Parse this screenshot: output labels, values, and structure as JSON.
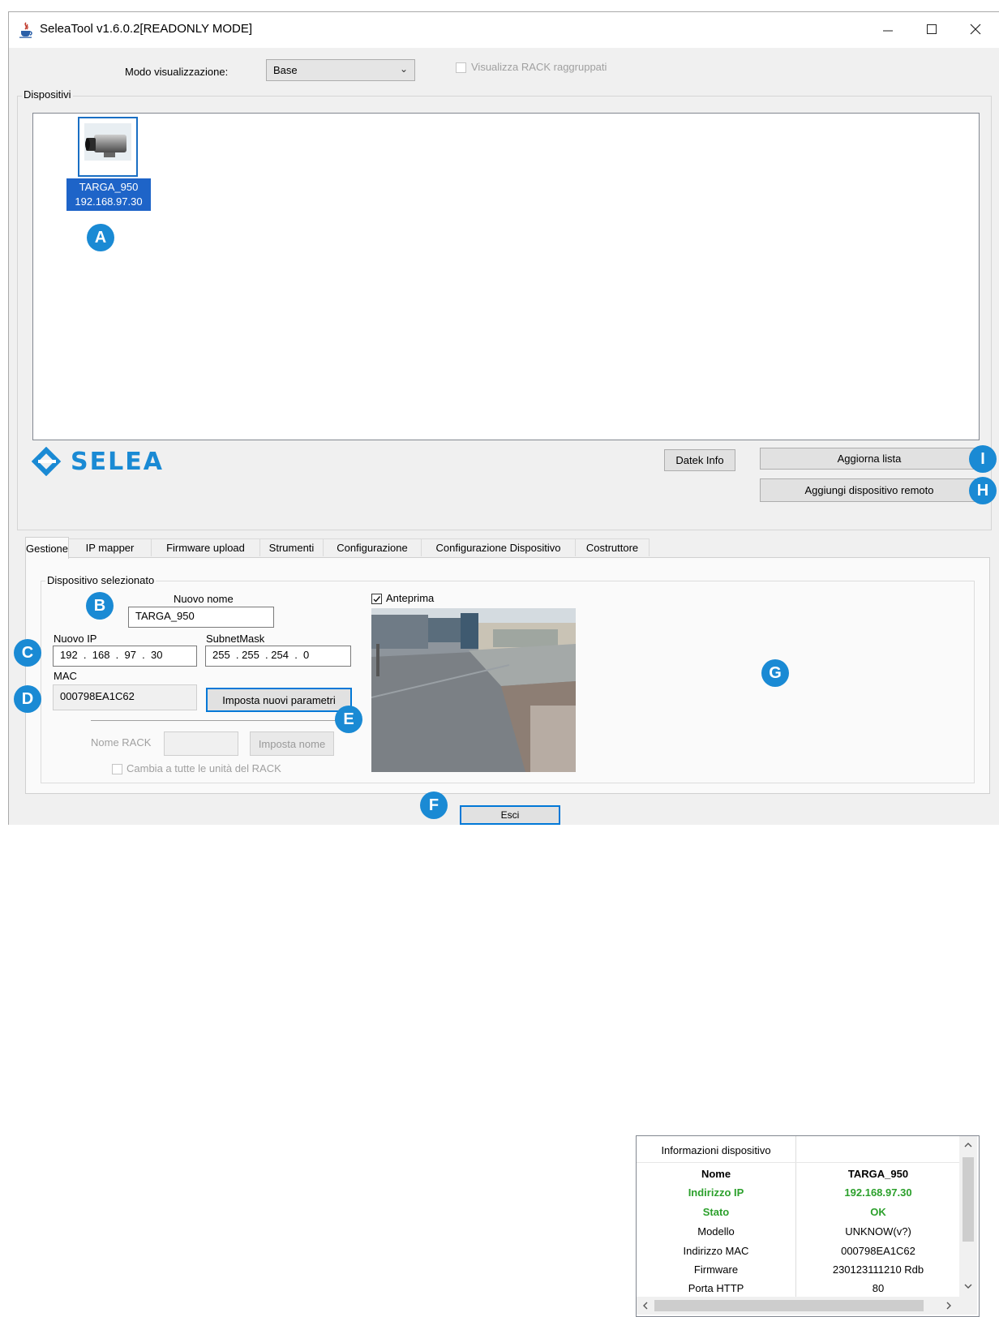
{
  "window": {
    "title": "SeleaTool v1.6.0.2[READONLY MODE]"
  },
  "toolbar": {
    "view_mode_label": "Modo visualizzazione:",
    "view_mode_value": "Base",
    "rack_grouped_label": "Visualizza RACK raggruppati",
    "rack_grouped_checked": false
  },
  "devices": {
    "legend": "Dispositivi",
    "items": [
      {
        "name": "TARGA_950",
        "ip": "192.168.97.30",
        "selected": true
      }
    ]
  },
  "brand": {
    "name": "SELEA",
    "color": "#1a8ad4"
  },
  "buttons": {
    "datek_info": "Datek Info",
    "refresh_list": "Aggiorna lista",
    "add_remote": "Aggiungi dispositivo remoto",
    "set_params": "Imposta nuovi parametri",
    "set_name": "Imposta nome",
    "exit": "Esci"
  },
  "tabs": [
    {
      "label": "Gestione",
      "active": true
    },
    {
      "label": "IP mapper"
    },
    {
      "label": "Firmware upload"
    },
    {
      "label": "Strumenti"
    },
    {
      "label": "Configurazione"
    },
    {
      "label": "Configurazione Dispositivo"
    },
    {
      "label": "Costruttore"
    }
  ],
  "selected_device": {
    "legend": "Dispositivo selezionato",
    "new_name_label": "Nuovo nome",
    "new_name_value": "TARGA_950",
    "new_ip_label": "Nuovo IP",
    "new_ip_value": "192  .  168  .  97  .  30",
    "subnet_label": "SubnetMask",
    "subnet_value": "255  . 255  . 254  .  0",
    "mac_label": "MAC",
    "mac_value": "000798EA1C62",
    "rack_name_label": "Nome RACK",
    "rack_name_value": "",
    "apply_all_rack_label": "Cambia a tutte le unità del RACK",
    "apply_all_rack_checked": false
  },
  "preview": {
    "label": "Anteprima",
    "checked": true
  },
  "device_info": {
    "header": "Informazioni dispositivo",
    "rows": [
      {
        "key": "Nome",
        "value": "TARGA_950",
        "bold": true
      },
      {
        "key": "Indirizzo IP",
        "value": "192.168.97.30",
        "color": "#2ca02c",
        "bold": true
      },
      {
        "key": "Stato",
        "value": "OK",
        "color": "#2ca02c",
        "bold": true
      },
      {
        "key": "Modello",
        "value": "UNKNOW(v?)"
      },
      {
        "key": "Indirizzo MAC",
        "value": "000798EA1C62"
      },
      {
        "key": "Firmware",
        "value": "230123111210 Rdb"
      },
      {
        "key": "Porta HTTP",
        "value": "80"
      }
    ]
  },
  "annotations": [
    "A",
    "B",
    "C",
    "D",
    "E",
    "F",
    "G",
    "H",
    "I"
  ]
}
